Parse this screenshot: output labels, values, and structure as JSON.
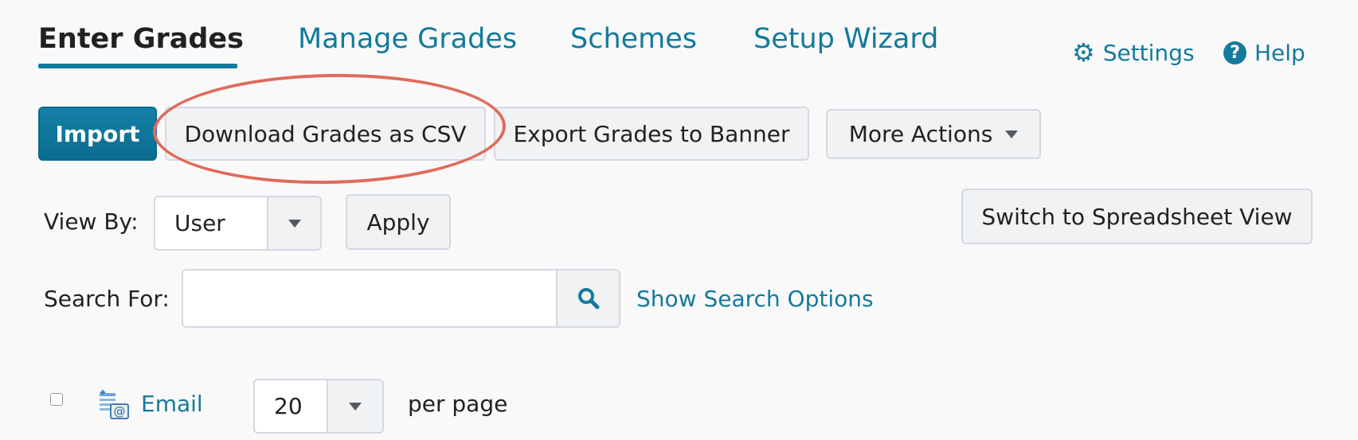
{
  "tabs": [
    {
      "label": "Enter Grades",
      "active": true
    },
    {
      "label": "Manage Grades"
    },
    {
      "label": "Schemes"
    },
    {
      "label": "Setup Wizard"
    }
  ],
  "top_links": {
    "settings": {
      "label": "Settings",
      "icon": "gear-icon"
    },
    "help": {
      "label": "Help",
      "icon": "help-icon"
    }
  },
  "toolbar": {
    "import": "Import",
    "download_csv": "Download Grades as CSV",
    "export_banner": "Export Grades to Banner",
    "more_actions": "More Actions"
  },
  "view_by": {
    "label": "View By:",
    "value": "User",
    "apply": "Apply"
  },
  "spreadsheet_button": "Switch to Spreadsheet View",
  "search": {
    "label": "Search For:",
    "value": "",
    "options_link": "Show Search Options"
  },
  "list_controls": {
    "email": "Email",
    "per_page_value": "20",
    "per_page_label": "per page"
  },
  "colors": {
    "link": "#137a9c",
    "primary": "#0d7aa0",
    "highlight_ellipse": "#e06a5b"
  }
}
